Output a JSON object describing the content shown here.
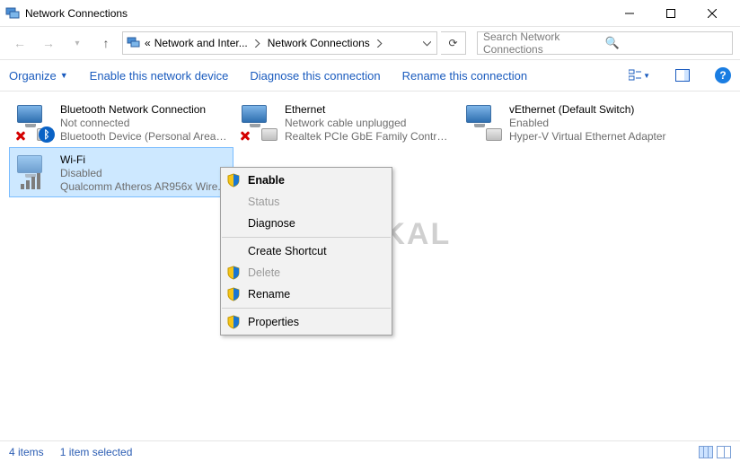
{
  "window": {
    "title": "Network Connections"
  },
  "nav": {
    "crumb_root_symbol": "«",
    "crumb1": "Network and Inter...",
    "crumb2": "Network Connections"
  },
  "search": {
    "placeholder": "Search Network Connections"
  },
  "commands": {
    "organize": "Organize",
    "enable_device": "Enable this network device",
    "diagnose": "Diagnose this connection",
    "rename": "Rename this connection"
  },
  "adapters": [
    {
      "name": "Bluetooth Network Connection",
      "line2": "Not connected",
      "line3": "Bluetooth Device (Personal Area ...",
      "kind": "bluetooth",
      "error": true
    },
    {
      "name": "Ethernet",
      "line2": "Network cable unplugged",
      "line3": "Realtek PCIe GbE Family Controller",
      "kind": "ethernet",
      "error": true
    },
    {
      "name": "vEthernet (Default Switch)",
      "line2": "Enabled",
      "line3": "Hyper-V Virtual Ethernet Adapter",
      "kind": "ethernet",
      "error": false
    },
    {
      "name": "Wi-Fi",
      "line2": "Disabled",
      "line3": "Qualcomm Atheros AR956x Wire...",
      "kind": "wifi",
      "error": false,
      "selected": true
    }
  ],
  "context_menu": {
    "enable": "Enable",
    "status": "Status",
    "diagnose": "Diagnose",
    "create_shortcut": "Create Shortcut",
    "delete": "Delete",
    "rename": "Rename",
    "properties": "Properties"
  },
  "status": {
    "items": "4 items",
    "selected": "1 item selected"
  },
  "watermark": "BERAKAL"
}
